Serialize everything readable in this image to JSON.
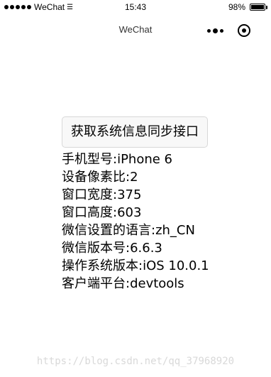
{
  "status_bar": {
    "carrier": "WeChat",
    "time": "15:43",
    "battery": "98%",
    "battery_level": 0.98
  },
  "nav": {
    "title": "WeChat"
  },
  "main": {
    "button_label": "获取系统信息同步接口",
    "info_lines": [
      "手机型号:iPhone 6",
      "设备像素比:2",
      "窗口宽度:375",
      "窗口高度:603",
      "微信设置的语言:zh_CN",
      "微信版本号:6.6.3",
      "操作系统版本:iOS 10.0.1",
      "客户端平台:devtools"
    ]
  },
  "watermark": "https://blog.csdn.net/qq_37968920"
}
